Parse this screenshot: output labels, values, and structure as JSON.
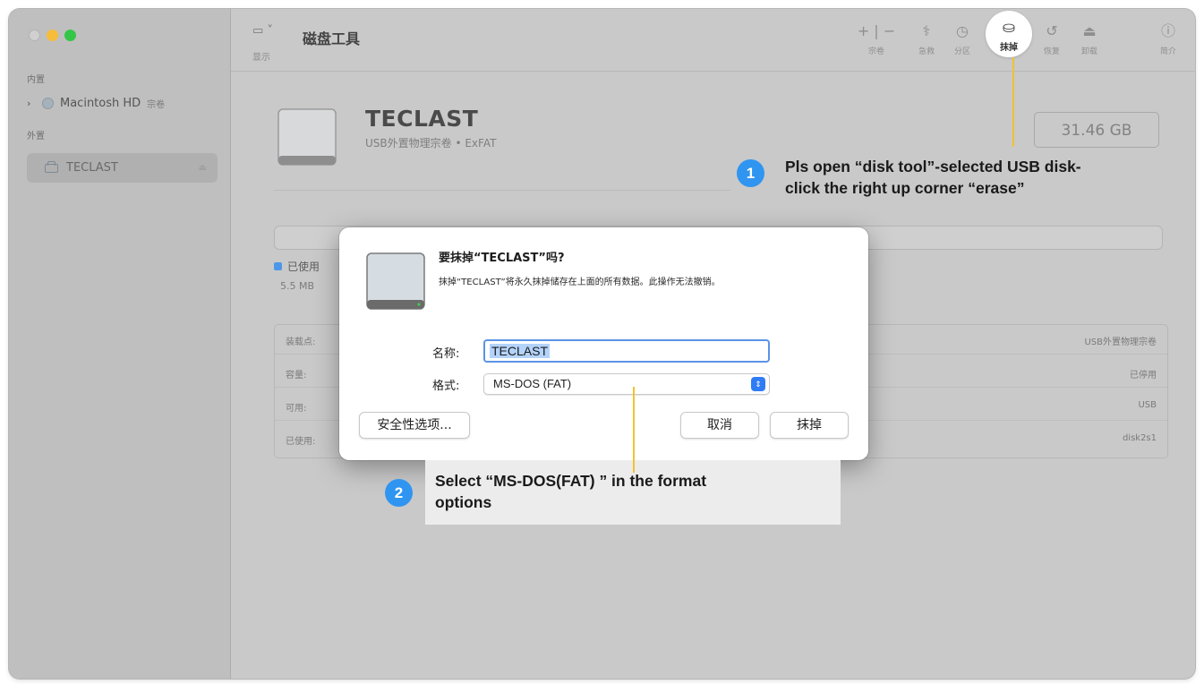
{
  "app": {
    "title": "磁盘工具",
    "view_label": "显示"
  },
  "sidebar": {
    "section_internal": "内置",
    "section_external": "外置",
    "internal_item": {
      "label": "Macintosh HD",
      "tag": "宗卷"
    },
    "external_item": {
      "label": "TECLAST"
    }
  },
  "toolbar": {
    "buttons": [
      {
        "icon": "+ | −",
        "label": "宗卷"
      },
      {
        "icon": "⚕",
        "label": "急救"
      },
      {
        "icon": "◷",
        "label": "分区"
      },
      {
        "icon": "⛀",
        "label": "抹掉"
      },
      {
        "icon": "↺",
        "label": "恢复"
      },
      {
        "icon": "⏏",
        "label": "卸载"
      },
      {
        "icon": "ⓘ",
        "label": "简介"
      }
    ]
  },
  "disk": {
    "name": "TECLAST",
    "subtitle": "USB外置物理宗卷 • ExFAT",
    "size": "31.46 GB",
    "used_label": "已使用",
    "used_value": "5.5 MB"
  },
  "info_table": [
    {
      "key": "装载点:",
      "value": "USB外置物理宗卷"
    },
    {
      "key": "容量:",
      "value": "已停用"
    },
    {
      "key": "可用:",
      "value": "USB"
    },
    {
      "key": "已使用:",
      "value": "disk2s1"
    }
  ],
  "dialog": {
    "title": "要抹掉“TECLAST”吗?",
    "description": "抹掉“TECLAST”将永久抹掉储存在上面的所有数据。此操作无法撤销。",
    "name_label": "名称:",
    "name_value": "TECLAST",
    "format_label": "格式:",
    "format_value": "MS-DOS (FAT)",
    "security_button": "安全性选项...",
    "cancel_button": "取消",
    "erase_button": "抹掉"
  },
  "annotations": {
    "step1_number": "1",
    "step1_line1": "Pls open “disk tool”-selected USB disk-",
    "step1_line2": "click the right up corner “erase”",
    "step2_number": "2",
    "step2_line1": "Select “MS-DOS(FAT) ” in the format",
    "step2_line2": "options",
    "color": "#f2c230",
    "badge_color": "#2f95f0"
  }
}
